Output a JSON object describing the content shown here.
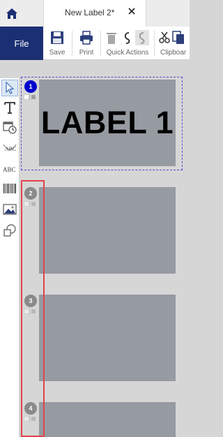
{
  "tabs": {
    "document_title": "New Label 2*"
  },
  "ribbon": {
    "file_label": "File",
    "save_label": "Save",
    "print_label": "Print",
    "quick_actions_label": "Quick Actions",
    "clipboard_label": "Clipboar"
  },
  "labels": [
    {
      "number": "1",
      "text": "LABEL 1",
      "selected": true
    },
    {
      "number": "2",
      "text": ""
    },
    {
      "number": "3",
      "text": ""
    },
    {
      "number": "4",
      "text": ""
    }
  ],
  "colors": {
    "file_button": "#1b2f73",
    "selection_badge": "#0000cc",
    "label_fill": "#969aa1",
    "highlight": "#e0444c"
  }
}
